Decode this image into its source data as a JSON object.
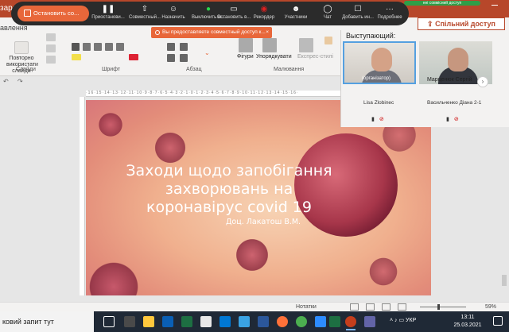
{
  "title_bar": {
    "doc_prefix": "зараж",
    "share_strip": "нні совмісний доступ"
  },
  "meeting_toolbar": {
    "stop_label": "Остановить со...",
    "items": [
      {
        "icon": "pause-icon",
        "label": "Приостанови..."
      },
      {
        "icon": "share-icon",
        "label": "Совместный..."
      },
      {
        "icon": "assign-icon",
        "label": "Назначить"
      },
      {
        "icon": "mic-icon",
        "label": "Выключить м..."
      },
      {
        "icon": "video-icon",
        "label": "Остановить в..."
      },
      {
        "icon": "record-icon",
        "label": "Рекордер"
      },
      {
        "icon": "participants-icon",
        "label": "Участники"
      },
      {
        "icon": "chat-icon",
        "label": "Чат"
      },
      {
        "icon": "add-icon",
        "label": "Добавить ин..."
      },
      {
        "icon": "more-icon",
        "label": "Подробнее"
      }
    ]
  },
  "notice": {
    "text": "Вы предоставляете совместный доступ к...",
    "close": "×"
  },
  "ribbon": {
    "tab_partial": "авлення",
    "repeat_button": "Повторно використати слайди",
    "group_slides": "Слайди",
    "group_font": "Шрифт",
    "group_paragraph": "Абзац",
    "group_drawing": "Малювання",
    "shapes_label": "Фігури",
    "arrange_label": "Упорядкувати",
    "styles_label": "Експрес-стилі",
    "share_button": "Спільний доступ"
  },
  "speakers": {
    "title": "Выступающий:",
    "tiles": [
      {
        "caption": "(організатор)",
        "name": "Lisa Zlobinec"
      },
      {
        "caption": "Марценюк Сергій",
        "name": "Васильченко Діана 2-1"
      }
    ]
  },
  "slide": {
    "title": "Заходи щодо запобігання захворювань на коронавірус covid 19",
    "author": "Доц. Лакатош В.М."
  },
  "ruler_text": "·16·15·14·13·12·11·10·9·8·7·6·5·4·3·2·1·0·1·2·3·4·5·6·7·8·9·10·11·12·13·14·15·16·",
  "status_bar": {
    "notes": "Нотатки",
    "zoom": "59%"
  },
  "taskbar": {
    "search": "ковий запит тут",
    "lang": "УКР",
    "time": "13:11",
    "date": "25.03.2021"
  },
  "colors": {
    "accent": "#b7472a",
    "meeting_orange": "#e8673a",
    "taskbar": "#1f2936"
  }
}
